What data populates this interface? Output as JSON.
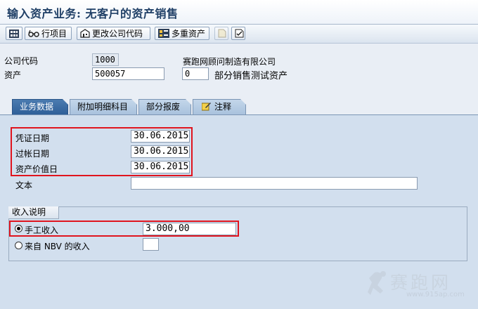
{
  "window": {
    "title": "输入资产业务: 无客户的资产销售"
  },
  "toolbar": {
    "line_items": "行项目",
    "change_company_code": "更改公司代码",
    "multiple_assets": "多重资产"
  },
  "header": {
    "company_code_label": "公司代码",
    "company_code_value": "1000",
    "company_name": "赛跑网顾问制造有限公司",
    "asset_label": "资产",
    "asset_value": "500057",
    "sub_number": "0",
    "asset_description": "部分销售测试资产"
  },
  "tabs": [
    {
      "label": "业务数据",
      "active": true
    },
    {
      "label": "附加明细科目",
      "active": false
    },
    {
      "label": "部分报废",
      "active": false
    },
    {
      "label": "注释",
      "active": false
    }
  ],
  "transaction": {
    "document_date_label": "凭证日期",
    "document_date": "30.06.2015",
    "posting_date_label": "过帐日期",
    "posting_date": "30.06.2015",
    "asset_value_date_label": "资产价值日",
    "asset_value_date": "30.06.2015",
    "text_label": "文本",
    "text_value": ""
  },
  "revenue": {
    "group_title": "收入说明",
    "manual_label": "手工收入",
    "manual_amount": "3.000,00",
    "nbv_label": "来自 NBV 的收入",
    "selected": "manual"
  },
  "watermark": {
    "text": "赛跑网",
    "url": "www.915ap.com"
  },
  "colors": {
    "highlight": "#e0141e",
    "tab_active": "#2e5f98",
    "title": "#1f3f66"
  }
}
